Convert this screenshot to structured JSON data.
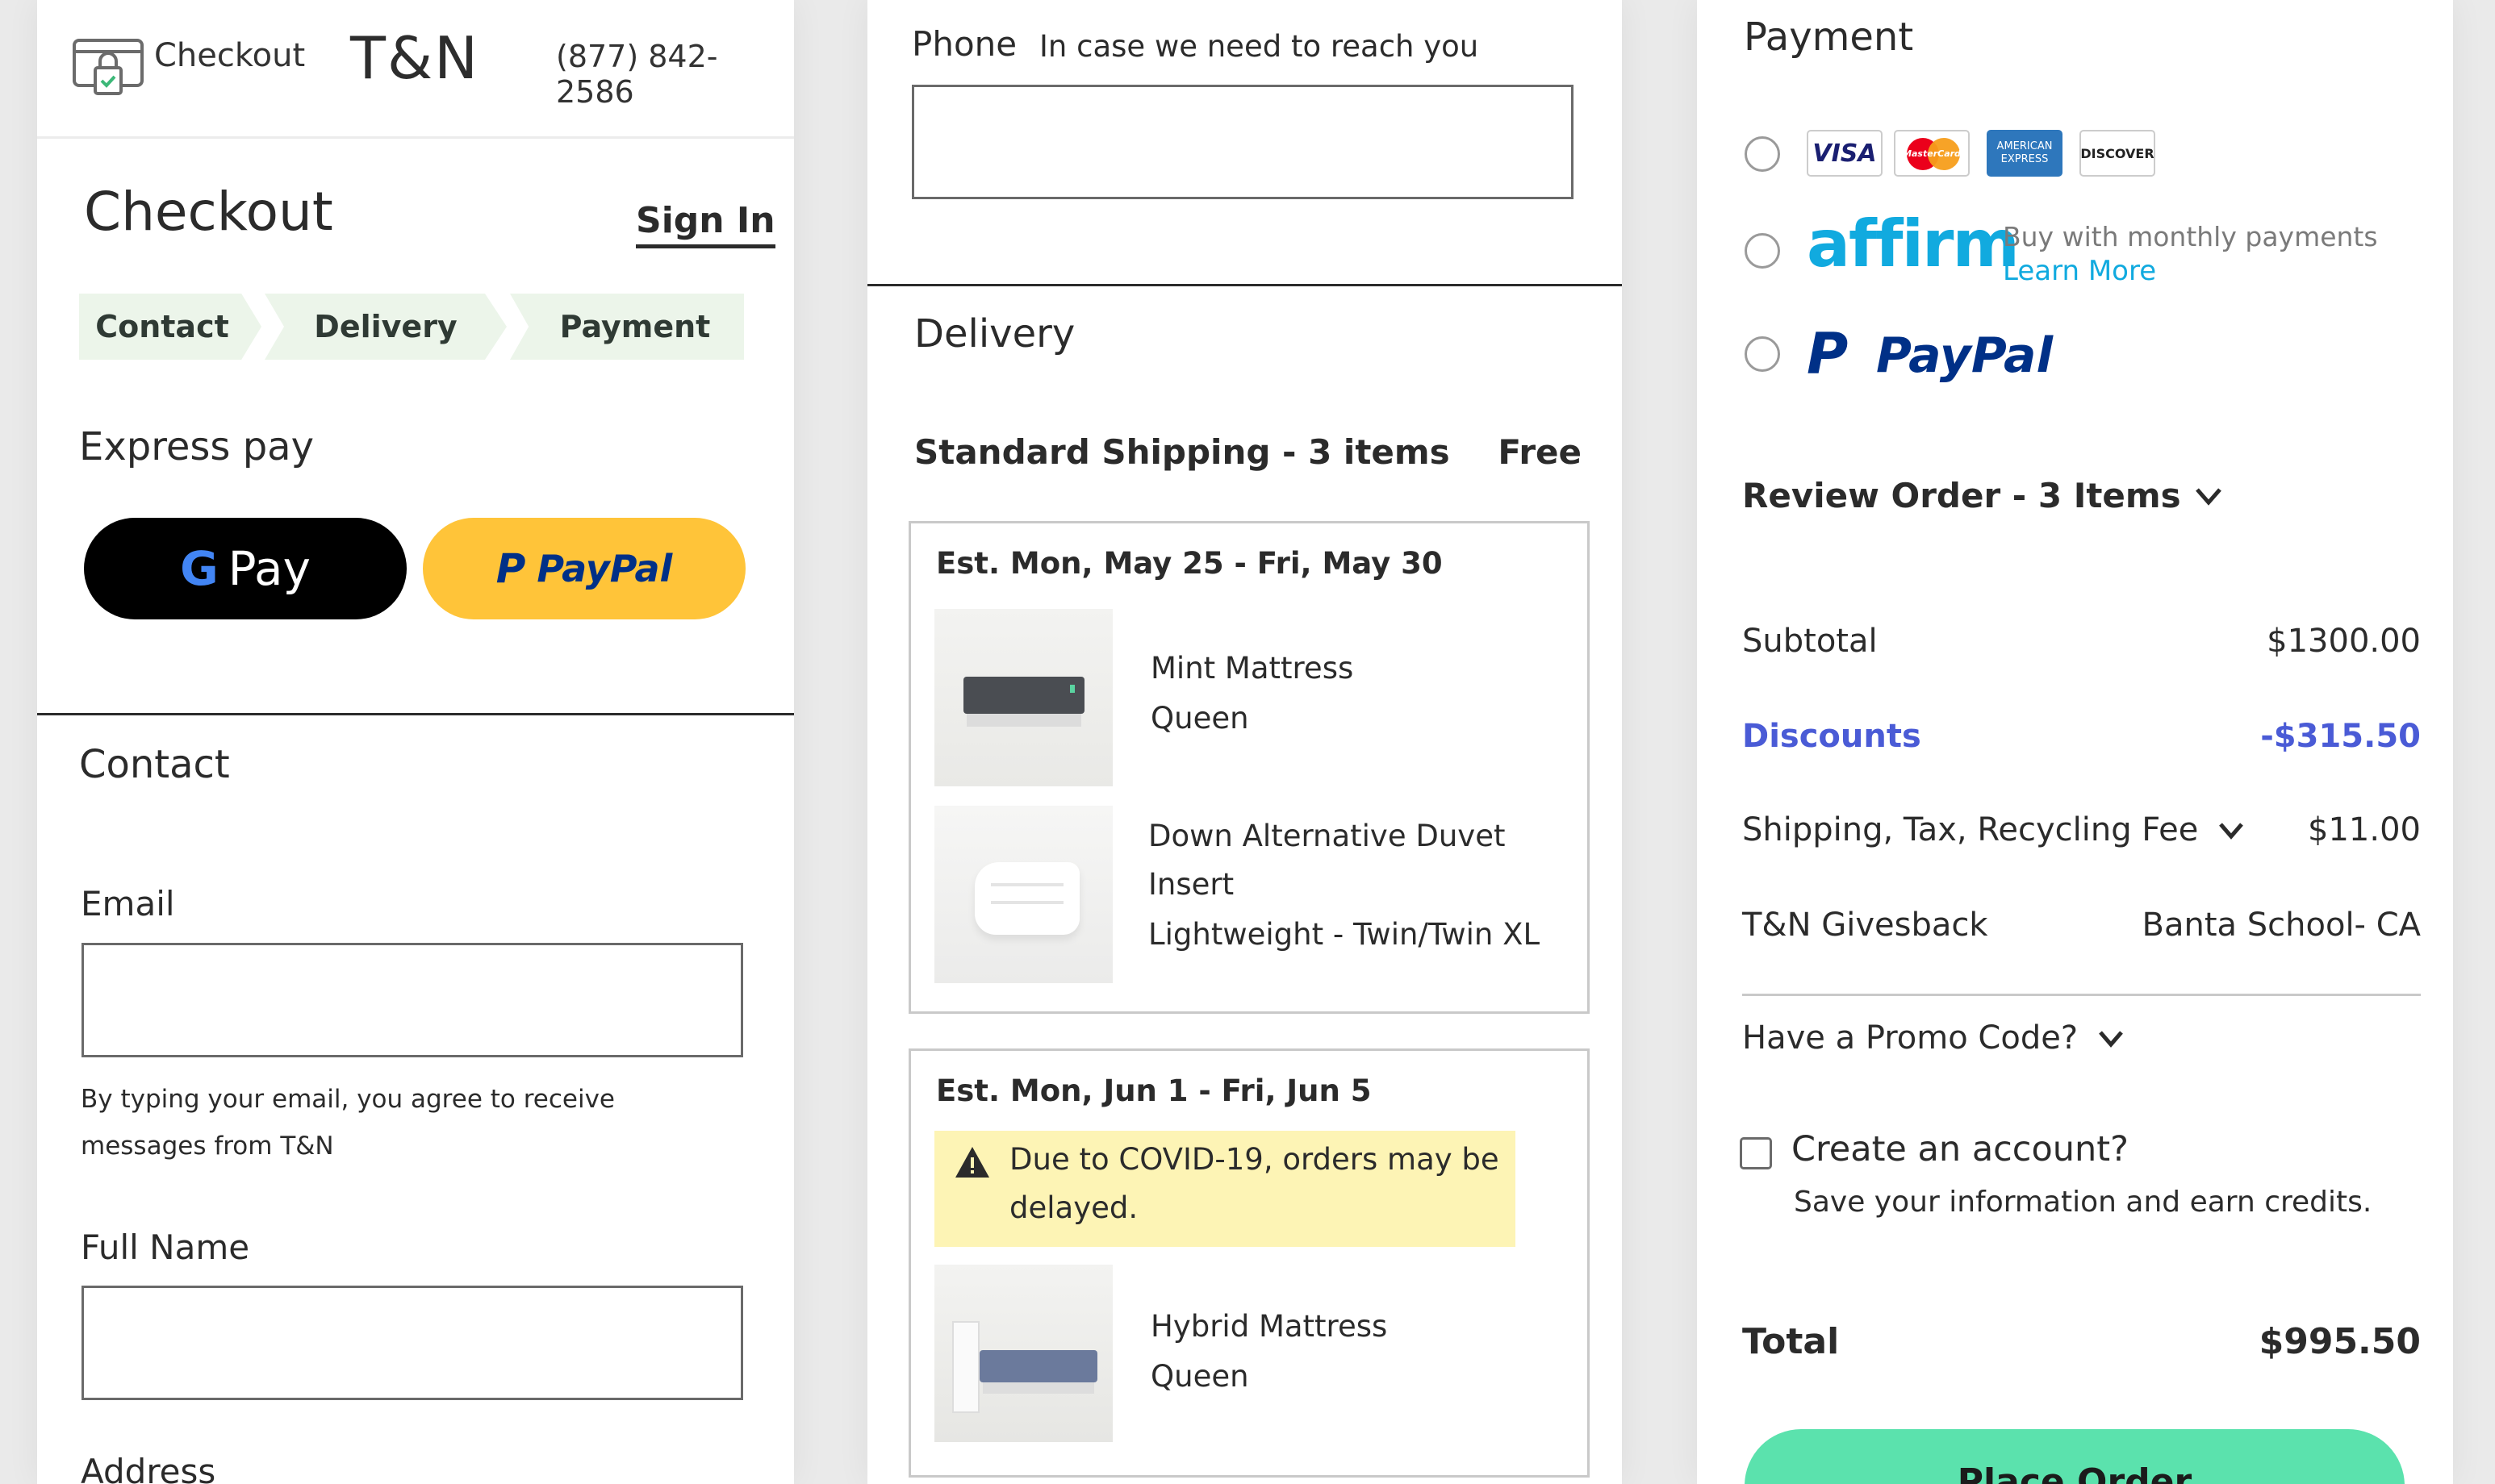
{
  "header": {
    "checkout_label": "Checkout",
    "logo": "T&N",
    "phone": "(877) 842-2586",
    "lock_icon": "lock-icon"
  },
  "checkout": {
    "title": "Checkout",
    "sign_in": "Sign In",
    "steps": [
      "Contact",
      "Delivery",
      "Payment"
    ],
    "express_pay_title": "Express pay",
    "gpay_label": "Pay",
    "paypal_label": "PayPal"
  },
  "contact": {
    "title": "Contact",
    "email_label": "Email",
    "email_value": "",
    "email_note": "By typing your email, you agree to receive messages from T&N",
    "full_name_label": "Full Name",
    "full_name_value": "",
    "address_label": "Address",
    "phone_label": "Phone",
    "phone_hint": "In case we need to reach you",
    "phone_value": ""
  },
  "delivery": {
    "title": "Delivery",
    "shipping_label": "Standard Shipping - 3 items",
    "shipping_price": "Free",
    "groups": [
      {
        "date_range": "Est. Mon, May 25 - Fri, May 30",
        "items": [
          {
            "name": "Mint Mattress",
            "variant": "Queen"
          },
          {
            "name": "Down Alternative Duvet",
            "name_line2": "Insert",
            "variant": "Lightweight - Twin/Twin XL"
          }
        ]
      },
      {
        "date_range": "Est. Mon, Jun 1 - Fri, Jun 5",
        "warning_line1": "Due to COVID-19, orders may be",
        "warning_line2": "delayed.",
        "items": [
          {
            "name": "Hybrid Mattress",
            "variant": "Queen"
          }
        ]
      }
    ]
  },
  "payment": {
    "title": "Payment",
    "card_logos": [
      "VISA",
      "MasterCard",
      "AMERICAN EXPRESS",
      "DISCOVER"
    ],
    "affirm_logo": "affirm",
    "affirm_text": "Buy with monthly payments",
    "affirm_link": "Learn More",
    "paypal_label": "PayPal"
  },
  "review": {
    "title": "Review Order - 3 Items",
    "subtotal_label": "Subtotal",
    "subtotal_value": "$1300.00",
    "discounts_label": "Discounts",
    "discounts_value": "-$315.50",
    "shipping_label": "Shipping, Tax, Recycling Fee",
    "shipping_value": "$11.00",
    "givesback_label": "T&N Givesback",
    "givesback_value": "Banta School- CA",
    "promo_label": "Have a Promo Code?",
    "create_account_label": "Create an account?",
    "create_account_sub": "Save your information and earn credits.",
    "total_label": "Total",
    "total_value": "$995.50",
    "place_order": "Place Order"
  },
  "colors": {
    "accent_blue": "#4a5bd6",
    "affirm_blue": "#11aadf",
    "paypal_yellow": "#ffc439",
    "crumb_bg": "#ecf5ea",
    "warning_bg": "#fdf4b5",
    "place_order_bg": "#5be2ad"
  }
}
